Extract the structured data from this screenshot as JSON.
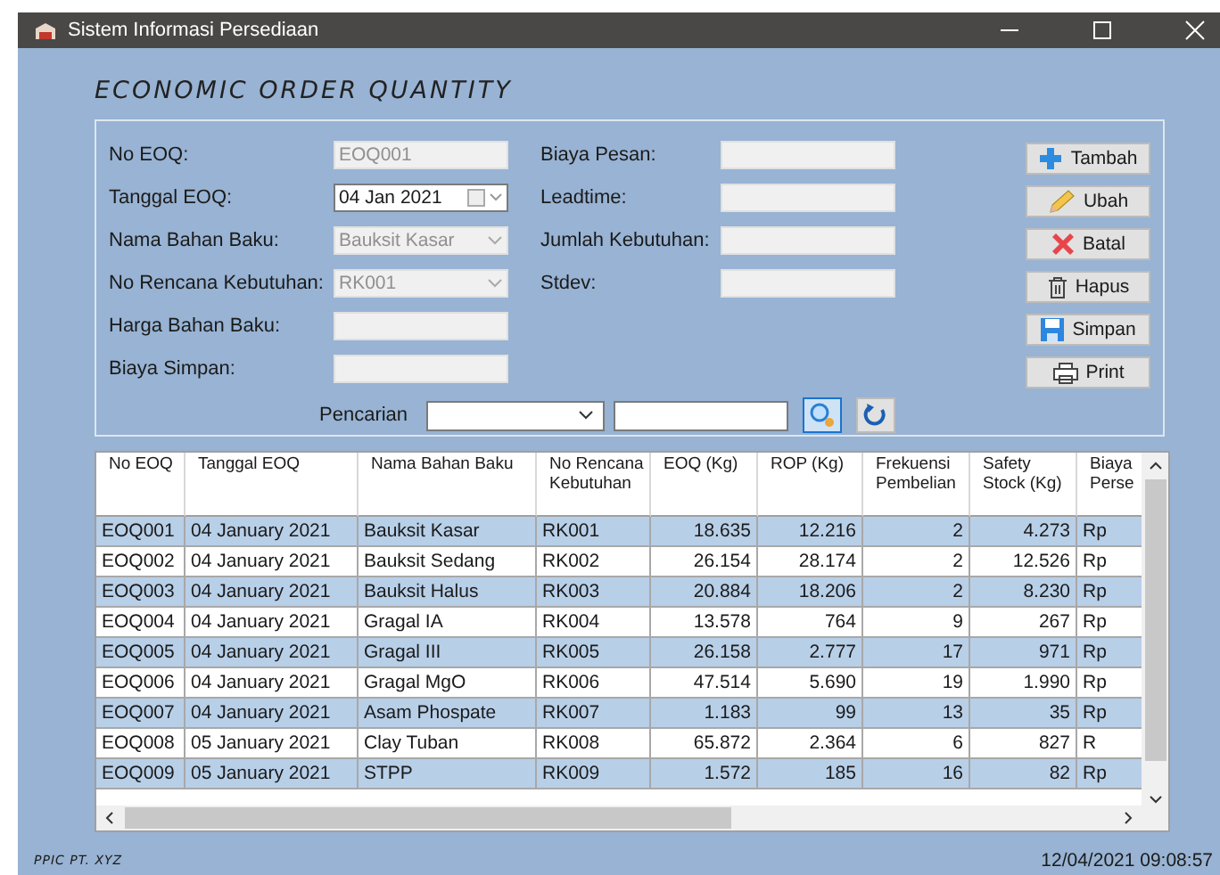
{
  "window": {
    "title": "Sistem Informasi Persediaan"
  },
  "heading": "ECONOMIC ORDER QUANTITY",
  "form": {
    "left_fields": [
      {
        "kind": "text",
        "label": "No EOQ:",
        "value": "EOQ001",
        "disabled": true
      },
      {
        "kind": "date",
        "label": "Tanggal EOQ:",
        "value": "04 Jan  2021",
        "disabled": false
      },
      {
        "kind": "combo",
        "label": "Nama Bahan Baku:",
        "value": "Bauksit Kasar",
        "disabled": true
      },
      {
        "kind": "combo",
        "label": "No Rencana Kebutuhan:",
        "value": "RK001",
        "disabled": true
      },
      {
        "kind": "text",
        "label": "Harga Bahan Baku:",
        "disabled": true
      },
      {
        "kind": "text",
        "label": "Biaya Simpan:",
        "disabled": true
      }
    ],
    "right_fields": [
      {
        "kind": "text",
        "label": "Biaya Pesan:",
        "disabled": true
      },
      {
        "kind": "text",
        "label": "Leadtime:",
        "disabled": true
      },
      {
        "kind": "text",
        "label": "Jumlah Kebutuhan:",
        "disabled": true
      },
      {
        "kind": "text",
        "label": "Stdev:",
        "disabled": true
      }
    ],
    "buttons": [
      {
        "kind": "add",
        "label": "Tambah"
      },
      {
        "kind": "edit",
        "label": "Ubah"
      },
      {
        "kind": "cancel",
        "label": "Batal"
      },
      {
        "kind": "delete",
        "label": "Hapus"
      },
      {
        "kind": "save",
        "label": "Simpan"
      },
      {
        "kind": "print",
        "label": "Print"
      }
    ],
    "search": {
      "label": "Pencarian"
    }
  },
  "table": {
    "columns": [
      "No EOQ",
      "Tanggal EOQ",
      "Nama Bahan Baku",
      "No Rencana Kebutuhan",
      "EOQ (Kg)",
      "ROP (Kg)",
      "Frekuensi Pembelian",
      "Safety Stock (Kg)",
      "Biaya Perse"
    ],
    "rows": [
      [
        "EOQ001",
        "04 January 2021",
        "Bauksit Kasar",
        "RK001",
        "18.635",
        "12.216",
        "2",
        "4.273",
        "Rp"
      ],
      [
        "EOQ002",
        "04 January 2021",
        "Bauksit Sedang",
        "RK002",
        "26.154",
        "28.174",
        "2",
        "12.526",
        "Rp"
      ],
      [
        "EOQ003",
        "04 January 2021",
        "Bauksit Halus",
        "RK003",
        "20.884",
        "18.206",
        "2",
        "8.230",
        "Rp"
      ],
      [
        "EOQ004",
        "04 January 2021",
        "Gragal IA",
        "RK004",
        "13.578",
        "764",
        "9",
        "267",
        "Rp"
      ],
      [
        "EOQ005",
        "04 January 2021",
        "Gragal III",
        "RK005",
        "26.158",
        "2.777",
        "17",
        "971",
        "Rp"
      ],
      [
        "EOQ006",
        "04 January 2021",
        "Gragal MgO",
        "RK006",
        "47.514",
        "5.690",
        "19",
        "1.990",
        "Rp"
      ],
      [
        "EOQ007",
        "04 January 2021",
        "Asam Phospate",
        "RK007",
        "1.183",
        "99",
        "13",
        "35",
        "Rp"
      ],
      [
        "EOQ008",
        "05 January 2021",
        "Clay Tuban",
        "RK008",
        "65.872",
        "2.364",
        "6",
        "827",
        "R"
      ],
      [
        "EOQ009",
        "05 January 2021",
        "STPP",
        "RK009",
        "1.572",
        "185",
        "16",
        "82",
        "Rp"
      ]
    ]
  },
  "status_bar": {
    "left": "PPIC PT. XYZ",
    "right": "12/04/2021 09:08:57"
  }
}
